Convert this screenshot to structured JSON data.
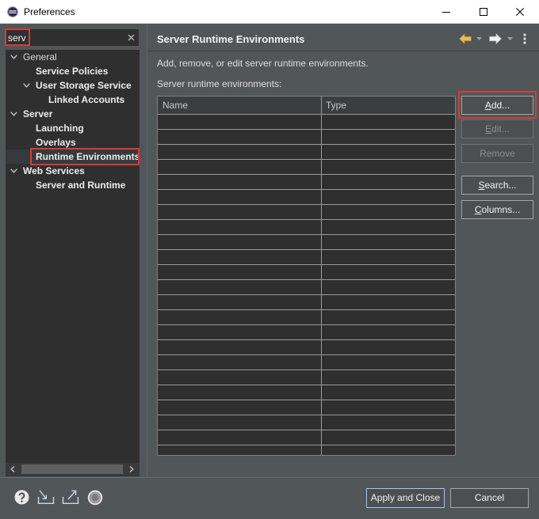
{
  "window": {
    "title": "Preferences",
    "app_icon": "eclipse-icon",
    "controls": [
      "minimize-icon",
      "maximize-icon",
      "close-icon"
    ]
  },
  "filter": {
    "value": "serv",
    "clear_icon": "clear-icon"
  },
  "tree": [
    {
      "label": "General",
      "expanded": true,
      "children": [
        {
          "label": "Service Policies"
        },
        {
          "label": "User Storage Service",
          "expanded": true,
          "children": [
            {
              "label": "Linked Accounts"
            }
          ]
        }
      ]
    },
    {
      "label": "Server",
      "expanded": true,
      "children": [
        {
          "label": "Launching"
        },
        {
          "label": "Overlays"
        },
        {
          "label": "Runtime Environments",
          "selected": true
        }
      ]
    },
    {
      "label": "Web Services",
      "expanded": true,
      "children": [
        {
          "label": "Server and Runtime"
        }
      ]
    }
  ],
  "tree_scrollbar": [
    "scroll-left-icon",
    "scroll-right-icon"
  ],
  "page": {
    "title": "Server Runtime Environments",
    "nav_icons": [
      "back-arrow-icon",
      "forward-arrow-icon",
      "view-menu-icon"
    ],
    "description": "Add, remove, or edit server runtime environments.",
    "table_label": "Server runtime environments:",
    "table": {
      "columns": [
        "Name",
        "Type"
      ],
      "rows": []
    },
    "buttons": {
      "add": {
        "label": "Add...",
        "enabled": true
      },
      "edit": {
        "label": "Edit...",
        "enabled": false
      },
      "remove": {
        "label": "Remove",
        "enabled": false
      },
      "search": {
        "label": "Search...",
        "enabled": true
      },
      "columns": {
        "label": "Columns...",
        "enabled": true
      }
    }
  },
  "footer": {
    "icons": [
      "help-icon",
      "import-icon",
      "export-icon",
      "oomph-icon"
    ],
    "apply_and_close": "Apply and Close",
    "cancel": "Cancel"
  },
  "colors": {
    "dialog_background": "#515658",
    "annotation_red": "#d93a36",
    "back_arrow": "#e5bf55"
  }
}
